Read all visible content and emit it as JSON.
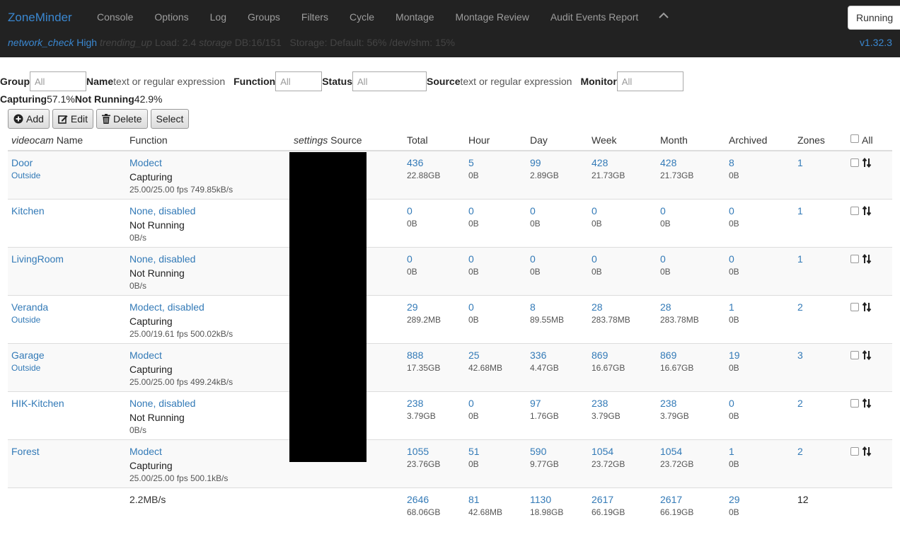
{
  "nav": {
    "brand": "ZoneMinder",
    "items": [
      "Console",
      "Options",
      "Log",
      "Groups",
      "Filters",
      "Cycle",
      "Montage",
      "Montage Review",
      "Audit Events Report"
    ],
    "state_button": "Running",
    "version": "v1.32.3"
  },
  "statusbar": {
    "network_icon": "network_check",
    "network_level": "High",
    "load_icon": "trending_up",
    "load": "Load: 2.4",
    "db_icon": "storage",
    "db": "DB:16/151",
    "storage": "Storage: Default: 56% /dev/shm: 15%"
  },
  "filters": {
    "group_label": "Group",
    "group_value": "All",
    "name_label": "Name",
    "name_placeholder": "text or regular expression",
    "function_label": "Function",
    "function_value": "All",
    "status_label": "Status",
    "status_value": "All",
    "source_label": "Source",
    "source_placeholder": "text or regular expression",
    "monitor_label": "Monitor",
    "monitor_value": "All"
  },
  "summary": {
    "capturing_label": "Capturing",
    "capturing_pct": "57.1%",
    "notrunning_label": "Not Running",
    "notrunning_pct": "42.9%"
  },
  "actions": {
    "add": "Add",
    "edit": "Edit",
    "delete": "Delete",
    "select": "Select"
  },
  "table": {
    "headers": {
      "name_icon": "videocam",
      "name": "Name",
      "function": "Function",
      "source_icon": "settings",
      "source": "Source",
      "total": "Total",
      "hour": "Hour",
      "day": "Day",
      "week": "Week",
      "month": "Month",
      "archived": "Archived",
      "zones": "Zones",
      "all": "All"
    },
    "rows": [
      {
        "name": "Door",
        "group": "Outside",
        "function": "Modect",
        "state": "Capturing",
        "fps": "25.00/25.00 fps 749.85kB/s",
        "total": "436",
        "total_size": "22.88GB",
        "hour": "5",
        "hour_size": "0B",
        "day": "99",
        "day_size": "2.89GB",
        "week": "428",
        "week_size": "21.73GB",
        "month": "428",
        "month_size": "21.73GB",
        "archived": "8",
        "archived_size": "0B",
        "zones": "1"
      },
      {
        "name": "Kitchen",
        "group": "",
        "function": "None, disabled",
        "state": "Not Running",
        "fps": "0B/s",
        "total": "0",
        "total_size": "0B",
        "hour": "0",
        "hour_size": "0B",
        "day": "0",
        "day_size": "0B",
        "week": "0",
        "week_size": "0B",
        "month": "0",
        "month_size": "0B",
        "archived": "0",
        "archived_size": "0B",
        "zones": "1"
      },
      {
        "name": "LivingRoom",
        "group": "",
        "function": "None, disabled",
        "state": "Not Running",
        "fps": "0B/s",
        "total": "0",
        "total_size": "0B",
        "hour": "0",
        "hour_size": "0B",
        "day": "0",
        "day_size": "0B",
        "week": "0",
        "week_size": "0B",
        "month": "0",
        "month_size": "0B",
        "archived": "0",
        "archived_size": "0B",
        "zones": "1"
      },
      {
        "name": "Veranda",
        "group": "Outside",
        "function": "Modect, disabled",
        "state": "Capturing",
        "fps": "25.00/19.61 fps 500.02kB/s",
        "total": "29",
        "total_size": "289.2MB",
        "hour": "0",
        "hour_size": "0B",
        "day": "8",
        "day_size": "89.55MB",
        "week": "28",
        "week_size": "283.78MB",
        "month": "28",
        "month_size": "283.78MB",
        "archived": "1",
        "archived_size": "0B",
        "zones": "2"
      },
      {
        "name": "Garage",
        "group": "Outside",
        "function": "Modect",
        "state": "Capturing",
        "fps": "25.00/25.00 fps 499.24kB/s",
        "total": "888",
        "total_size": "17.35GB",
        "hour": "25",
        "hour_size": "42.68MB",
        "day": "336",
        "day_size": "4.47GB",
        "week": "869",
        "week_size": "16.67GB",
        "month": "869",
        "month_size": "16.67GB",
        "archived": "19",
        "archived_size": "0B",
        "zones": "3"
      },
      {
        "name": "HIK-Kitchen",
        "group": "",
        "function": "None, disabled",
        "state": "Not Running",
        "fps": "0B/s",
        "total": "238",
        "total_size": "3.79GB",
        "hour": "0",
        "hour_size": "0B",
        "day": "97",
        "day_size": "1.76GB",
        "week": "238",
        "week_size": "3.79GB",
        "month": "238",
        "month_size": "3.79GB",
        "archived": "0",
        "archived_size": "0B",
        "zones": "2"
      },
      {
        "name": "Forest",
        "group": "",
        "function": "Modect",
        "state": "Capturing",
        "fps": "25.00/25.00 fps 500.1kB/s",
        "total": "1055",
        "total_size": "23.76GB",
        "hour": "51",
        "hour_size": "0B",
        "day": "590",
        "day_size": "9.77GB",
        "week": "1054",
        "week_size": "23.72GB",
        "month": "1054",
        "month_size": "23.72GB",
        "archived": "1",
        "archived_size": "0B",
        "zones": "2"
      }
    ],
    "footer": {
      "bandwidth": "2.2MB/s",
      "total": "2646",
      "total_size": "68.06GB",
      "hour": "81",
      "hour_size": "42.68MB",
      "day": "1130",
      "day_size": "18.98GB",
      "week": "2617",
      "week_size": "66.19GB",
      "month": "2617",
      "month_size": "66.19GB",
      "archived": "29",
      "archived_size": "0B",
      "zones": "12"
    }
  }
}
